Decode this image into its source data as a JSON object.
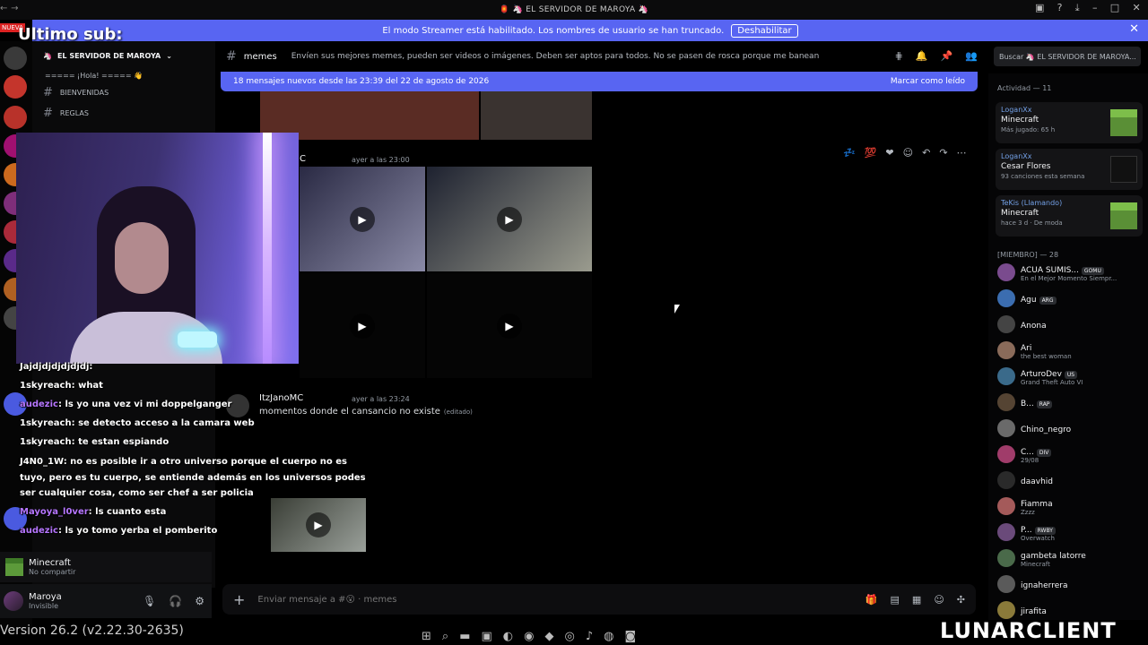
{
  "window": {
    "title": "🏮 🦄 EL SERVIDOR DE MAROYA 🦄"
  },
  "banner": {
    "text": "El modo Streamer está habilitado. Los nombres de usuario se han truncado.",
    "disable_label": "Deshabilitar"
  },
  "overlay": {
    "title": "Ultimo sub:",
    "badge": "NUEVA"
  },
  "server": {
    "name": "EL SERVIDOR DE MAROYA",
    "channels": [
      {
        "name": "===== ¡Hola! ===== 👋"
      },
      {
        "name": "BIENVENIDAS"
      },
      {
        "name": "REGLAS"
      }
    ]
  },
  "channel_header": {
    "name": "memes",
    "topic": "Envíen sus mejores memes, pueden ser videos o imágenes. Deben ser aptos para todos. No se pasen de rosca porque me banean"
  },
  "new_messages": {
    "text": "18 mensajes nuevos desde las 23:39 del 22 de agosto de 2026",
    "mark_read": "Marcar como leído"
  },
  "messages": [
    {
      "author": "C",
      "time": "ayer a las 23:00"
    },
    {
      "author": "ItzJanoMC",
      "time": "ayer a las 23:24",
      "text": "momentos donde el cansancio no existe",
      "edited": "(editado)"
    }
  ],
  "composer": {
    "placeholder": "Enviar mensaje a #😮 · memes"
  },
  "search": {
    "placeholder": "Buscar 🦄 EL SERVIDOR DE MAROYA..."
  },
  "activity": {
    "header": "Actividad — 11",
    "cards": [
      {
        "user": "LoganXx",
        "title": "Minecraft",
        "sub": "Más jugado: 65 h"
      },
      {
        "user": "LoganXx",
        "title": "Cesar Flores",
        "sub": "93 canciones esta semana"
      },
      {
        "user": "TeKis (Llamando)",
        "title": "Minecraft",
        "sub": "hace 3 d · De moda"
      }
    ]
  },
  "members": {
    "header": "[MIEMBRO] — 28",
    "list": [
      {
        "name": "ACUA SUMIS...",
        "tag": "GOMU",
        "sub": "En el Mejor Momento Siempr..."
      },
      {
        "name": "Agu",
        "tag": "ARG",
        "sub": ""
      },
      {
        "name": "Anona",
        "tag": "",
        "sub": ""
      },
      {
        "name": "Ari",
        "tag": "",
        "sub": "the best woman"
      },
      {
        "name": "ArturoDev",
        "tag": "US",
        "sub": "Grand Theft Auto VI"
      },
      {
        "name": "B...",
        "tag": "RAP",
        "sub": ""
      },
      {
        "name": "Chino_negro",
        "tag": "",
        "sub": ""
      },
      {
        "name": "C...",
        "tag": "DIV",
        "sub": "29/08"
      },
      {
        "name": "daavhid",
        "tag": "",
        "sub": ""
      },
      {
        "name": "Fiamma",
        "tag": "",
        "sub": "Zzzz"
      },
      {
        "name": "P...",
        "tag": "RWBY",
        "sub": "Overwatch"
      },
      {
        "name": "gambeta latorre",
        "tag": "",
        "sub": "Minecraft"
      },
      {
        "name": "ignaherrera",
        "tag": "",
        "sub": ""
      },
      {
        "name": "jirafita",
        "tag": "",
        "sub": ""
      }
    ]
  },
  "stream_chat": [
    {
      "user": "Jajdjdjdjdjdjdj",
      "text": ":"
    },
    {
      "user": "1skyreach",
      "text": ": what"
    },
    {
      "user": "audezic",
      "text": ": ls yo una vez vi mi doppelganger"
    },
    {
      "user": "1skyreach",
      "text": ": se detecto acceso a la camara web"
    },
    {
      "user": "1skyreach",
      "text": ": te estan espiando"
    },
    {
      "user": "J4N0_1W",
      "text": ": no es posible ir a otro universo porque el cuerpo no es"
    },
    {
      "user": "",
      "text": "tuyo, pero es tu cuerpo, se entiende además en los universos podes"
    },
    {
      "user": "",
      "text": "ser cualquier cosa, como ser chef a ser policia"
    },
    {
      "user": "Mayoya_l0ver",
      "text": ": ls cuanto esta"
    },
    {
      "user": "audezic",
      "text": ": ls yo tomo yerba el pomberito"
    }
  ],
  "game_panel": {
    "title": "Minecraft",
    "sub": "No compartir"
  },
  "user": {
    "name": "Maroya",
    "status": "Invisible"
  },
  "footer": {
    "version": "Version 26.2 (v2.22.30-2635)",
    "brand": "LUNARCLIENT"
  }
}
